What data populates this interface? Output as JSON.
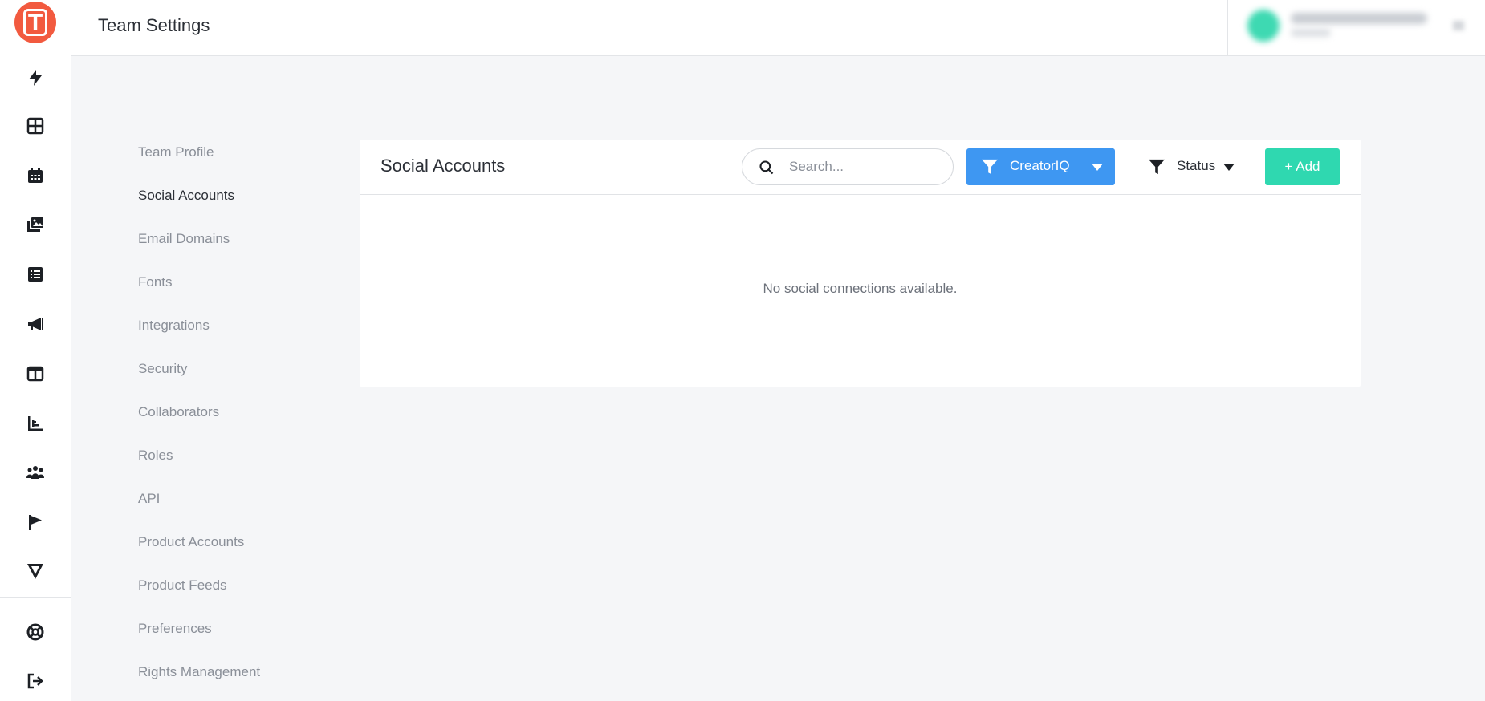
{
  "app": {
    "logo_letter": "T",
    "brand_color": "#f25a3f"
  },
  "header": {
    "title": "Team Settings"
  },
  "rail": {
    "icons": [
      "bolt-icon",
      "grid-icon",
      "calendar-icon",
      "media-library-icon",
      "list-icon",
      "megaphone-icon",
      "columns-icon",
      "bar-chart-icon",
      "people-icon",
      "flag-icon",
      "v-logo-icon",
      "help-lifebuoy-icon",
      "logout-icon"
    ]
  },
  "subnav": {
    "items": [
      {
        "label": "Team Profile",
        "active": false
      },
      {
        "label": "Social Accounts",
        "active": true
      },
      {
        "label": "Email Domains",
        "active": false
      },
      {
        "label": "Fonts",
        "active": false
      },
      {
        "label": "Integrations",
        "active": false
      },
      {
        "label": "Security",
        "active": false
      },
      {
        "label": "Collaborators",
        "active": false
      },
      {
        "label": "Roles",
        "active": false
      },
      {
        "label": "API",
        "active": false
      },
      {
        "label": "Product Accounts",
        "active": false
      },
      {
        "label": "Product Feeds",
        "active": false
      },
      {
        "label": "Preferences",
        "active": false
      },
      {
        "label": "Rights Management",
        "active": false
      }
    ]
  },
  "panel": {
    "title": "Social Accounts",
    "search": {
      "placeholder": "Search...",
      "value": ""
    },
    "source_filter": {
      "label": "CreatorIQ",
      "color": "#3e97f2"
    },
    "status_filter": {
      "label": "Status"
    },
    "add_button": {
      "label": "+ Add",
      "color": "#2fd8b0"
    },
    "empty_message": "No social connections available."
  }
}
